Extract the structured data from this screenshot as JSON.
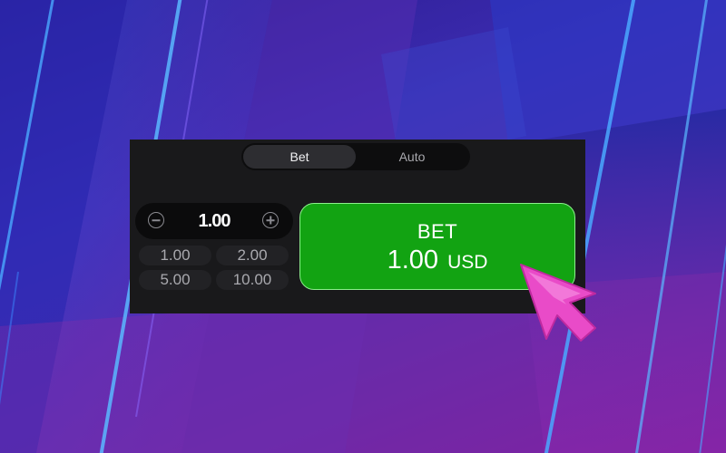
{
  "mode_tabs": {
    "bet": "Bet",
    "auto": "Auto",
    "active": "Bet"
  },
  "stepper": {
    "value": "1.00"
  },
  "presets": [
    "1.00",
    "2.00",
    "5.00",
    "10.00"
  ],
  "bet_button": {
    "label": "BET",
    "amount": "1.00",
    "currency": "USD"
  },
  "colors": {
    "bet_button": "#12a312",
    "panel": "#19191b",
    "cursor": "#e94bc8"
  },
  "icons": {
    "minus": "minus-circle-icon",
    "plus": "plus-circle-icon",
    "pointer": "mouse-pointer-icon"
  }
}
